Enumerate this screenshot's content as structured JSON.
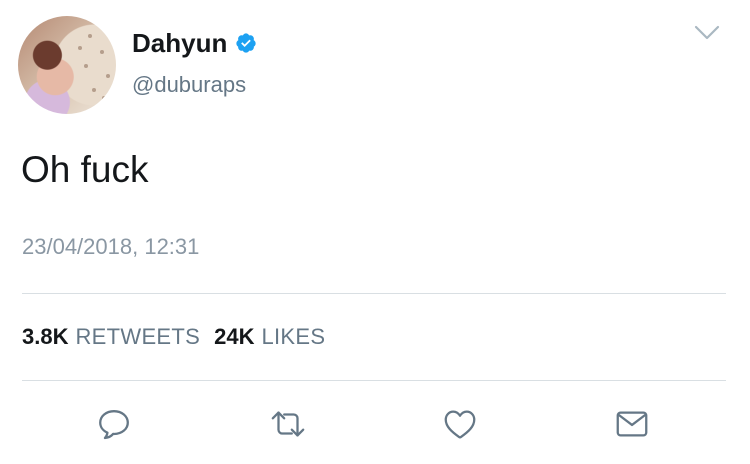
{
  "user": {
    "display_name": "Dahyun",
    "handle": "@duburaps",
    "verified": true
  },
  "tweet": {
    "text": "Oh fuck",
    "timestamp": "23/04/2018, 12:31"
  },
  "stats": {
    "retweets_count": "3.8K",
    "retweets_label": "RETWEETS",
    "likes_count": "24K",
    "likes_label": "LIKES"
  },
  "icons": {
    "menu": "chevron-down-icon",
    "verified": "verified-badge-icon",
    "reply": "reply-icon",
    "retweet": "retweet-icon",
    "like": "heart-icon",
    "dm": "mail-icon"
  },
  "colors": {
    "verified_blue": "#1da1f2",
    "icon_gray": "#657786",
    "text_primary": "#14171a",
    "text_secondary": "#657786"
  }
}
